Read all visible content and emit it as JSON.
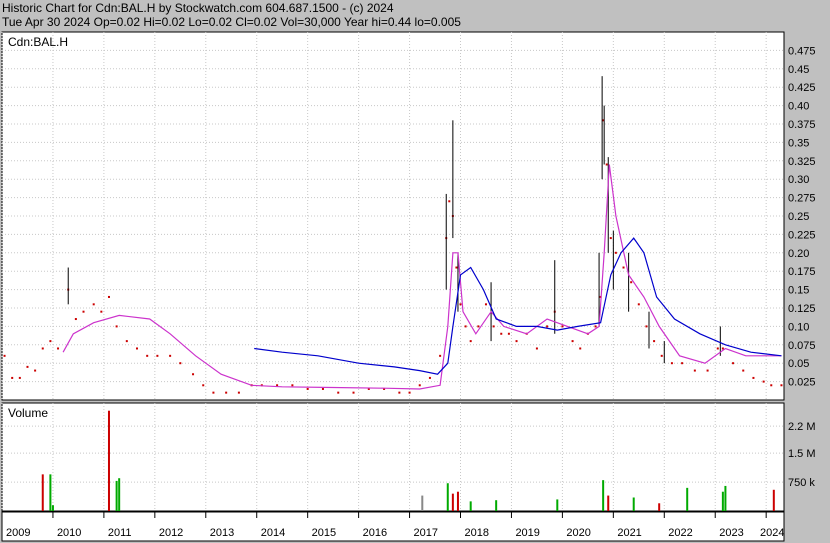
{
  "header": {
    "line1": "Historic Chart for Cdn:BAL.H by Stockwatch.com 604.687.1500 - (c) 2024",
    "line2": "Tue Apr 30 2024  Op=0.02  Hi=0.02  Lo=0.02  Cl=0.02  Vol=30,000  Year hi=0.44  lo=0.005"
  },
  "chart_data": [
    {
      "type": "line",
      "panel": "price",
      "label": "Cdn:BAL.H",
      "ylim": [
        0,
        0.5
      ],
      "yticks": [
        "0.475",
        "0.45",
        "0.425",
        "0.40",
        "0.375",
        "0.35",
        "0.325",
        "0.30",
        "0.275",
        "0.25",
        "0.225",
        "0.20",
        "0.175",
        "0.15",
        "0.125",
        "0.10",
        "0.075",
        "0.05",
        "0.025"
      ],
      "ytick_values": [
        0.475,
        0.45,
        0.425,
        0.4,
        0.375,
        0.35,
        0.325,
        0.3,
        0.275,
        0.25,
        0.225,
        0.2,
        0.175,
        0.15,
        0.125,
        0.1,
        0.075,
        0.05,
        0.025
      ],
      "xlim": [
        2009.0,
        2024.35
      ],
      "x_labels": [
        "2009",
        "2010",
        "2011",
        "2012",
        "2013",
        "2014",
        "2015",
        "2016",
        "2017",
        "2018",
        "2019",
        "2020",
        "2021",
        "2022",
        "2023",
        "2024"
      ],
      "x_label_positions": [
        2009,
        2010,
        2011,
        2012,
        2013,
        2014,
        2015,
        2016,
        2017,
        2018,
        2019,
        2020,
        2021,
        2022,
        2023,
        2024
      ],
      "grid": true,
      "series": [
        {
          "kind": "close",
          "color": "#cc0000",
          "points": [
            [
              2009.05,
              0.06
            ],
            [
              2009.2,
              0.03
            ],
            [
              2009.35,
              0.03
            ],
            [
              2009.5,
              0.045
            ],
            [
              2009.65,
              0.04
            ],
            [
              2009.8,
              0.07
            ],
            [
              2009.95,
              0.08
            ],
            [
              2010.1,
              0.07
            ],
            [
              2010.3,
              0.15
            ],
            [
              2010.45,
              0.11
            ],
            [
              2010.6,
              0.12
            ],
            [
              2010.8,
              0.13
            ],
            [
              2010.95,
              0.12
            ],
            [
              2011.1,
              0.14
            ],
            [
              2011.25,
              0.1
            ],
            [
              2011.45,
              0.08
            ],
            [
              2011.65,
              0.07
            ],
            [
              2011.85,
              0.06
            ],
            [
              2012.05,
              0.06
            ],
            [
              2012.3,
              0.06
            ],
            [
              2012.5,
              0.05
            ],
            [
              2012.75,
              0.035
            ],
            [
              2012.95,
              0.02
            ],
            [
              2013.15,
              0.01
            ],
            [
              2013.4,
              0.01
            ],
            [
              2013.65,
              0.01
            ],
            [
              2013.9,
              0.02
            ],
            [
              2014.1,
              0.02
            ],
            [
              2014.4,
              0.02
            ],
            [
              2014.7,
              0.02
            ],
            [
              2015.0,
              0.015
            ],
            [
              2015.3,
              0.015
            ],
            [
              2015.6,
              0.01
            ],
            [
              2015.9,
              0.01
            ],
            [
              2016.2,
              0.015
            ],
            [
              2016.5,
              0.015
            ],
            [
              2016.8,
              0.01
            ],
            [
              2017.0,
              0.01
            ],
            [
              2017.2,
              0.02
            ],
            [
              2017.4,
              0.03
            ],
            [
              2017.6,
              0.06
            ],
            [
              2017.72,
              0.22
            ],
            [
              2017.78,
              0.27
            ],
            [
              2017.85,
              0.25
            ],
            [
              2017.92,
              0.18
            ],
            [
              2018.0,
              0.13
            ],
            [
              2018.1,
              0.1
            ],
            [
              2018.2,
              0.08
            ],
            [
              2018.35,
              0.1
            ],
            [
              2018.5,
              0.13
            ],
            [
              2018.65,
              0.1
            ],
            [
              2018.8,
              0.09
            ],
            [
              2018.95,
              0.09
            ],
            [
              2019.1,
              0.08
            ],
            [
              2019.3,
              0.09
            ],
            [
              2019.5,
              0.07
            ],
            [
              2019.7,
              0.1
            ],
            [
              2019.85,
              0.12
            ],
            [
              2020.0,
              0.1
            ],
            [
              2020.2,
              0.08
            ],
            [
              2020.35,
              0.07
            ],
            [
              2020.5,
              0.09
            ],
            [
              2020.65,
              0.1
            ],
            [
              2020.75,
              0.14
            ],
            [
              2020.8,
              0.38
            ],
            [
              2020.87,
              0.32
            ],
            [
              2020.95,
              0.22
            ],
            [
              2021.05,
              0.2
            ],
            [
              2021.2,
              0.18
            ],
            [
              2021.35,
              0.16
            ],
            [
              2021.5,
              0.13
            ],
            [
              2021.65,
              0.1
            ],
            [
              2021.8,
              0.08
            ],
            [
              2021.95,
              0.06
            ],
            [
              2022.15,
              0.05
            ],
            [
              2022.35,
              0.05
            ],
            [
              2022.6,
              0.04
            ],
            [
              2022.85,
              0.04
            ],
            [
              2023.05,
              0.07
            ],
            [
              2023.15,
              0.07
            ],
            [
              2023.35,
              0.05
            ],
            [
              2023.55,
              0.04
            ],
            [
              2023.75,
              0.03
            ],
            [
              2023.95,
              0.025
            ],
            [
              2024.1,
              0.02
            ],
            [
              2024.3,
              0.02
            ]
          ]
        },
        {
          "kind": "high_low",
          "color": "#000000",
          "points": [
            [
              2010.3,
              0.13,
              0.18
            ],
            [
              2017.72,
              0.15,
              0.28
            ],
            [
              2017.85,
              0.22,
              0.38
            ],
            [
              2017.95,
              0.12,
              0.2
            ],
            [
              2018.6,
              0.08,
              0.16
            ],
            [
              2019.85,
              0.09,
              0.19
            ],
            [
              2020.72,
              0.1,
              0.2
            ],
            [
              2020.78,
              0.3,
              0.44
            ],
            [
              2020.82,
              0.32,
              0.4
            ],
            [
              2020.9,
              0.2,
              0.33
            ],
            [
              2021.0,
              0.15,
              0.23
            ],
            [
              2021.3,
              0.12,
              0.2
            ],
            [
              2021.7,
              0.07,
              0.12
            ],
            [
              2022.0,
              0.05,
              0.08
            ],
            [
              2023.1,
              0.06,
              0.1
            ]
          ]
        },
        {
          "kind": "ma_short",
          "color": "#cc33cc",
          "points": [
            [
              2010.2,
              0.065
            ],
            [
              2010.4,
              0.09
            ],
            [
              2010.8,
              0.105
            ],
            [
              2011.3,
              0.115
            ],
            [
              2011.9,
              0.11
            ],
            [
              2012.3,
              0.09
            ],
            [
              2012.8,
              0.06
            ],
            [
              2013.3,
              0.035
            ],
            [
              2013.9,
              0.02
            ],
            [
              2014.5,
              0.018
            ],
            [
              2015.5,
              0.017
            ],
            [
              2016.5,
              0.016
            ],
            [
              2017.2,
              0.015
            ],
            [
              2017.6,
              0.02
            ],
            [
              2017.75,
              0.1
            ],
            [
              2017.85,
              0.2
            ],
            [
              2017.95,
              0.2
            ],
            [
              2018.05,
              0.12
            ],
            [
              2018.3,
              0.09
            ],
            [
              2018.6,
              0.12
            ],
            [
              2018.85,
              0.1
            ],
            [
              2019.3,
              0.09
            ],
            [
              2019.7,
              0.11
            ],
            [
              2020.1,
              0.1
            ],
            [
              2020.5,
              0.09
            ],
            [
              2020.72,
              0.1
            ],
            [
              2020.82,
              0.2
            ],
            [
              2020.92,
              0.32
            ],
            [
              2021.05,
              0.25
            ],
            [
              2021.3,
              0.17
            ],
            [
              2021.6,
              0.14
            ],
            [
              2021.9,
              0.1
            ],
            [
              2022.3,
              0.06
            ],
            [
              2022.8,
              0.05
            ],
            [
              2023.2,
              0.07
            ],
            [
              2023.6,
              0.06
            ],
            [
              2024.1,
              0.06
            ],
            [
              2024.3,
              0.06
            ]
          ]
        },
        {
          "kind": "ma_long",
          "color": "#0000cc",
          "points": [
            [
              2013.95,
              0.07
            ],
            [
              2014.5,
              0.065
            ],
            [
              2015.2,
              0.06
            ],
            [
              2016.0,
              0.05
            ],
            [
              2016.7,
              0.045
            ],
            [
              2017.2,
              0.04
            ],
            [
              2017.55,
              0.035
            ],
            [
              2017.75,
              0.05
            ],
            [
              2017.85,
              0.1
            ],
            [
              2018.0,
              0.17
            ],
            [
              2018.2,
              0.18
            ],
            [
              2018.45,
              0.15
            ],
            [
              2018.7,
              0.11
            ],
            [
              2019.1,
              0.1
            ],
            [
              2019.5,
              0.1
            ],
            [
              2019.9,
              0.095
            ],
            [
              2020.3,
              0.1
            ],
            [
              2020.75,
              0.105
            ],
            [
              2020.95,
              0.17
            ],
            [
              2021.15,
              0.2
            ],
            [
              2021.4,
              0.22
            ],
            [
              2021.6,
              0.2
            ],
            [
              2021.85,
              0.14
            ],
            [
              2022.2,
              0.11
            ],
            [
              2022.7,
              0.09
            ],
            [
              2023.2,
              0.075
            ],
            [
              2023.7,
              0.065
            ],
            [
              2024.3,
              0.06
            ]
          ]
        }
      ]
    },
    {
      "type": "bar",
      "panel": "volume",
      "label": "Volume",
      "ylim": [
        0,
        2800000
      ],
      "yticks": [
        "2.2 M",
        "1.5 M",
        "750 k"
      ],
      "ytick_values": [
        2200000,
        1500000,
        750000
      ],
      "xlim": [
        2009.0,
        2024.35
      ],
      "grid": true,
      "bars": [
        [
          2009.8,
          950000,
          "#cc0000"
        ],
        [
          2009.95,
          950000,
          "#00aa00"
        ],
        [
          2010.0,
          150000,
          "#00aa00"
        ],
        [
          2011.1,
          2600000,
          "#cc0000"
        ],
        [
          2011.25,
          780000,
          "#00aa00"
        ],
        [
          2011.3,
          850000,
          "#00aa00"
        ],
        [
          2017.25,
          400000,
          "#888888"
        ],
        [
          2017.75,
          720000,
          "#00aa00"
        ],
        [
          2017.85,
          450000,
          "#cc0000"
        ],
        [
          2017.95,
          500000,
          "#cc0000"
        ],
        [
          2018.2,
          250000,
          "#00aa00"
        ],
        [
          2018.7,
          280000,
          "#00aa00"
        ],
        [
          2019.9,
          300000,
          "#00aa00"
        ],
        [
          2020.8,
          800000,
          "#00aa00"
        ],
        [
          2020.9,
          400000,
          "#cc0000"
        ],
        [
          2021.4,
          350000,
          "#00aa00"
        ],
        [
          2021.9,
          200000,
          "#cc0000"
        ],
        [
          2022.45,
          600000,
          "#00aa00"
        ],
        [
          2023.15,
          500000,
          "#00aa00"
        ],
        [
          2023.2,
          650000,
          "#00aa00"
        ],
        [
          2024.15,
          550000,
          "#cc0000"
        ]
      ]
    }
  ]
}
